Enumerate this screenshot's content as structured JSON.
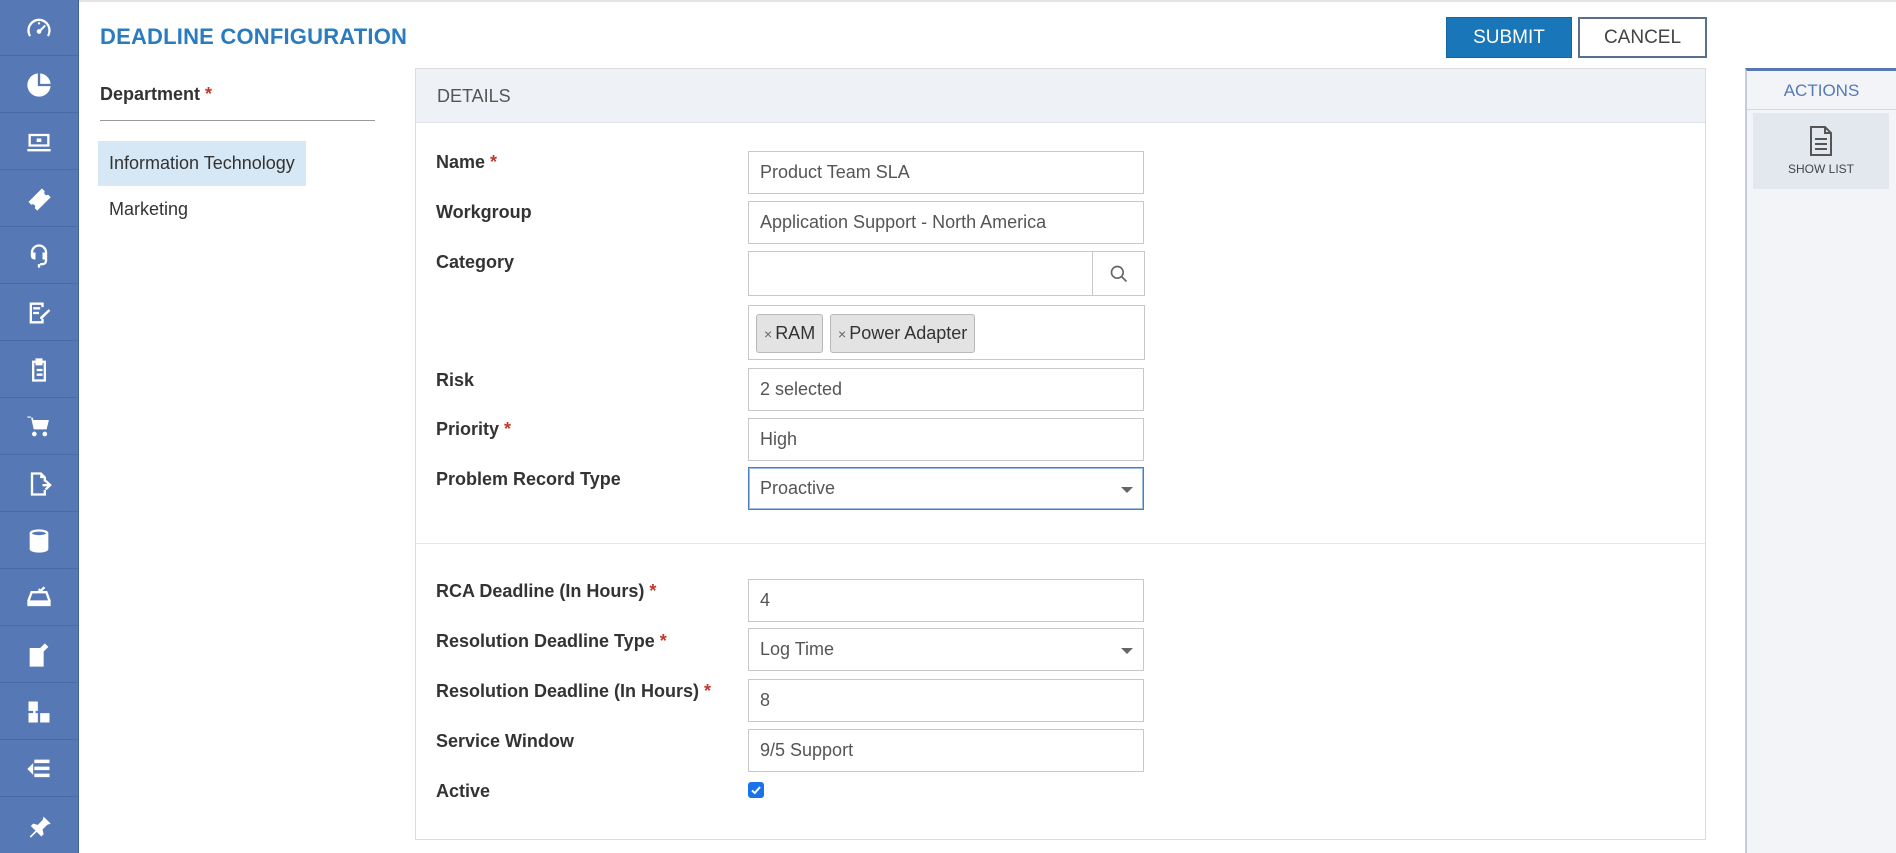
{
  "header": {
    "title": "DEADLINE CONFIGURATION",
    "submit_label": "SUBMIT",
    "cancel_label": "CANCEL"
  },
  "rail": {
    "icons": [
      "dashboard-icon",
      "pie-chart-icon",
      "monitor-icon",
      "ticket-icon",
      "support-agent-icon",
      "edit-document-icon",
      "clipboard-icon",
      "cart-icon",
      "document-export-icon",
      "database-icon",
      "inbox-tray-icon",
      "notebook-icon",
      "workflow-icon",
      "list-stack-icon",
      "pin-icon"
    ]
  },
  "department": {
    "label": "Department",
    "required_mark": "*",
    "items": [
      {
        "label": "Information Technology",
        "selected": true
      },
      {
        "label": "Marketing",
        "selected": false
      }
    ]
  },
  "details": {
    "section_title": "DETAILS",
    "name": {
      "label": "Name",
      "value": "Product Team SLA"
    },
    "workgroup": {
      "label": "Workgroup",
      "value": "Application Support - North America"
    },
    "category": {
      "label": "Category",
      "value": "",
      "tags": [
        "RAM",
        "Power Adapter"
      ],
      "tag_remove_glyph": "×"
    },
    "risk": {
      "label": "Risk",
      "value": "2 selected"
    },
    "priority": {
      "label": "Priority",
      "value": "High"
    },
    "problem_record_type": {
      "label": "Problem Record Type",
      "value": "Proactive"
    },
    "rca_deadline": {
      "label": "RCA Deadline (In Hours)",
      "value": "4"
    },
    "resolution_deadline_type": {
      "label": "Resolution Deadline Type",
      "value": "Log Time"
    },
    "resolution_deadline": {
      "label": "Resolution Deadline (In Hours)",
      "value": "8"
    },
    "service_window": {
      "label": "Service Window",
      "value": "9/5 Support"
    },
    "active": {
      "label": "Active",
      "checked": true
    },
    "required_mark": "*"
  },
  "actions": {
    "title": "ACTIONS",
    "show_list_label": "SHOW LIST"
  },
  "colors": {
    "rail": "#5679b5",
    "accent": "#1976b8",
    "title": "#2a7bbf",
    "selected_item": "#d6e8f5",
    "required": "#c0392b"
  }
}
